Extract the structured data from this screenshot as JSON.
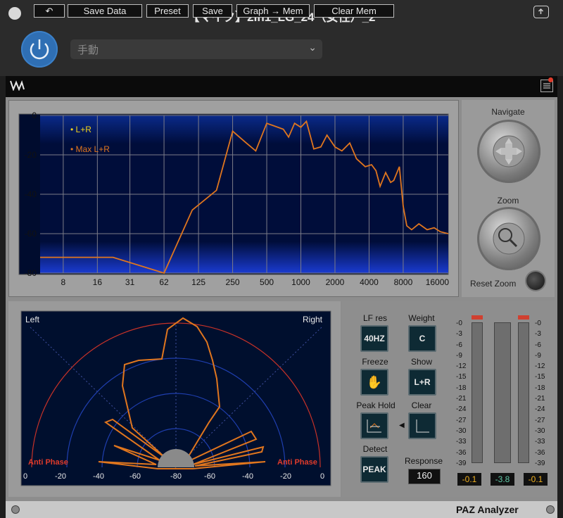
{
  "window": {
    "title": "【マイク】2in1_LG_24（女性）_2",
    "preset_value": "手動"
  },
  "toolbar": {
    "save_data": "Save Data",
    "preset": "Preset",
    "save": "Save",
    "graph_mem": "Graph → Mem",
    "clear_mem": "Clear Mem"
  },
  "graph": {
    "legend": [
      "• L+R",
      "• Max L+R"
    ],
    "y_ticks": [
      "0",
      "-20",
      "-40",
      "-60",
      "-80"
    ],
    "x_ticks": [
      "8",
      "16",
      "31",
      "62",
      "125",
      "250",
      "500",
      "1000",
      "2000",
      "4000",
      "8000",
      "16000"
    ]
  },
  "chart_data": {
    "type": "line",
    "xscale": "log",
    "xlim": [
      5,
      20000
    ],
    "ylim": [
      -80,
      0
    ],
    "series": [
      {
        "name": "Max L+R",
        "color": "#e0761e",
        "points": [
          [
            5,
            -72
          ],
          [
            22,
            -72
          ],
          [
            62,
            -80
          ],
          [
            110,
            -48
          ],
          [
            180,
            -38
          ],
          [
            250,
            -8
          ],
          [
            330,
            -14
          ],
          [
            400,
            -18
          ],
          [
            500,
            -4
          ],
          [
            560,
            -5
          ],
          [
            700,
            -7
          ],
          [
            780,
            -11
          ],
          [
            880,
            -4
          ],
          [
            1000,
            -6
          ],
          [
            1120,
            -3
          ],
          [
            1300,
            -17
          ],
          [
            1500,
            -16
          ],
          [
            1700,
            -10
          ],
          [
            2000,
            -16
          ],
          [
            2300,
            -18
          ],
          [
            2700,
            -14
          ],
          [
            3100,
            -22
          ],
          [
            3700,
            -26
          ],
          [
            4200,
            -25
          ],
          [
            4600,
            -28
          ],
          [
            5000,
            -36
          ],
          [
            5600,
            -29
          ],
          [
            6200,
            -34
          ],
          [
            6600,
            -33
          ],
          [
            7400,
            -26
          ],
          [
            8000,
            -46
          ],
          [
            8600,
            -56
          ],
          [
            9500,
            -58
          ],
          [
            11000,
            -55
          ],
          [
            13000,
            -58
          ],
          [
            15000,
            -57
          ],
          [
            17000,
            -59
          ],
          [
            20000,
            -60
          ]
        ]
      }
    ]
  },
  "side": {
    "navigate": "Navigate",
    "zoom": "Zoom",
    "reset_zoom": "Reset Zoom"
  },
  "phase": {
    "left": "Left",
    "right": "Right",
    "anti_left": "Anti Phase",
    "anti_right": "Anti Phase",
    "ticks": [
      "0",
      "-20",
      "-40",
      "-60",
      "-80",
      "-60",
      "-40",
      "-20",
      "0"
    ]
  },
  "controls": {
    "lf_res": "LF res",
    "lf_res_value": "40HZ",
    "weight": "Weight",
    "weight_value": "C",
    "freeze": "Freeze",
    "show": "Show",
    "show_value": "L+R",
    "peak_hold": "Peak Hold",
    "clear": "Clear",
    "detect": "Detect",
    "detect_value": "PEAK",
    "response": "Response",
    "response_value": "160"
  },
  "meters": {
    "scale": [
      "-0",
      "-3",
      "-6",
      "-9",
      "-12",
      "-15",
      "-18",
      "-21",
      "-24",
      "-27",
      "-30",
      "-33",
      "-36",
      "-39"
    ],
    "left_value": "-0.1",
    "center_value": "-3.8",
    "right_value": "-0.1"
  },
  "footer": {
    "brand": "PAZ Analyzer"
  }
}
